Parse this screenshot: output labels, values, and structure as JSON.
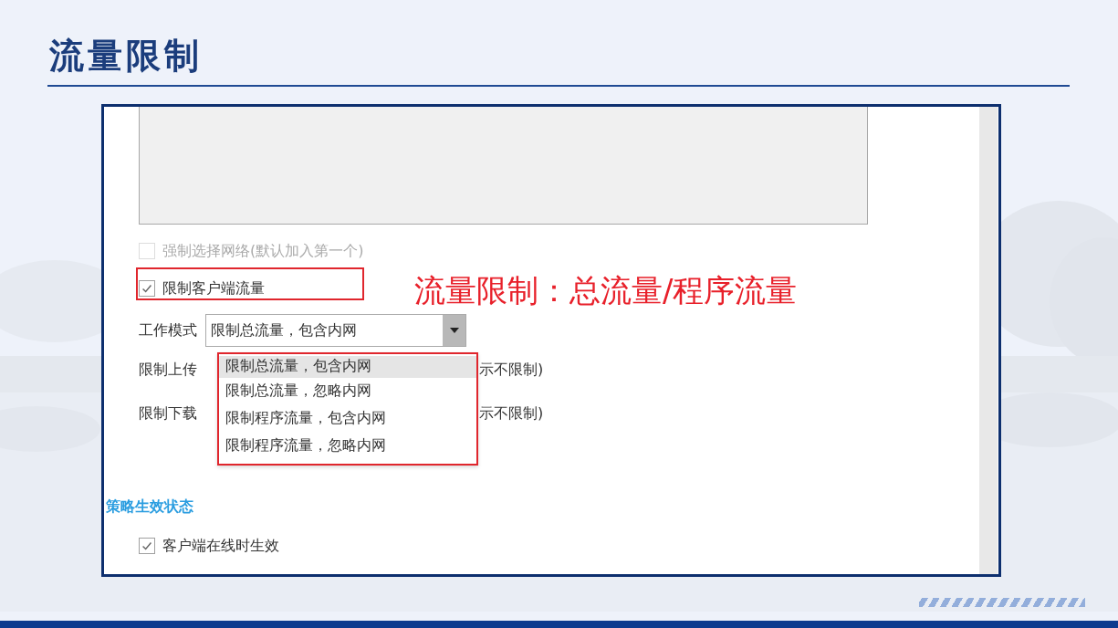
{
  "slide": {
    "title": "流量限制",
    "annotation": "流量限制：总流量/程序流量"
  },
  "form": {
    "force_network": {
      "label": "强制选择网络(默认加入第一个)",
      "checked": false,
      "disabled": true
    },
    "limit_traffic": {
      "label": "限制客户端流量",
      "checked": true,
      "disabled": false,
      "highlighted": true
    },
    "work_mode": {
      "label": "工作模式",
      "value": "限制总流量，包含内网",
      "expanded": true,
      "options_highlighted": true,
      "options": [
        {
          "label": "限制总流量，包含内网",
          "selected": true
        },
        {
          "label": "限制总流量，忽略内网",
          "selected": false
        },
        {
          "label": "限制程序流量，包含内网",
          "selected": false
        },
        {
          "label": "限制程序流量，忽略内网",
          "selected": false
        }
      ]
    },
    "upload_limit": {
      "label": "限制上传",
      "hint": "示不限制)"
    },
    "download_limit": {
      "label": "限制下载",
      "hint": "示不限制)"
    },
    "section": {
      "title": "策略生效状态"
    },
    "online_effect": {
      "label": "客户端在线时生效",
      "checked": true,
      "disabled": false
    }
  }
}
